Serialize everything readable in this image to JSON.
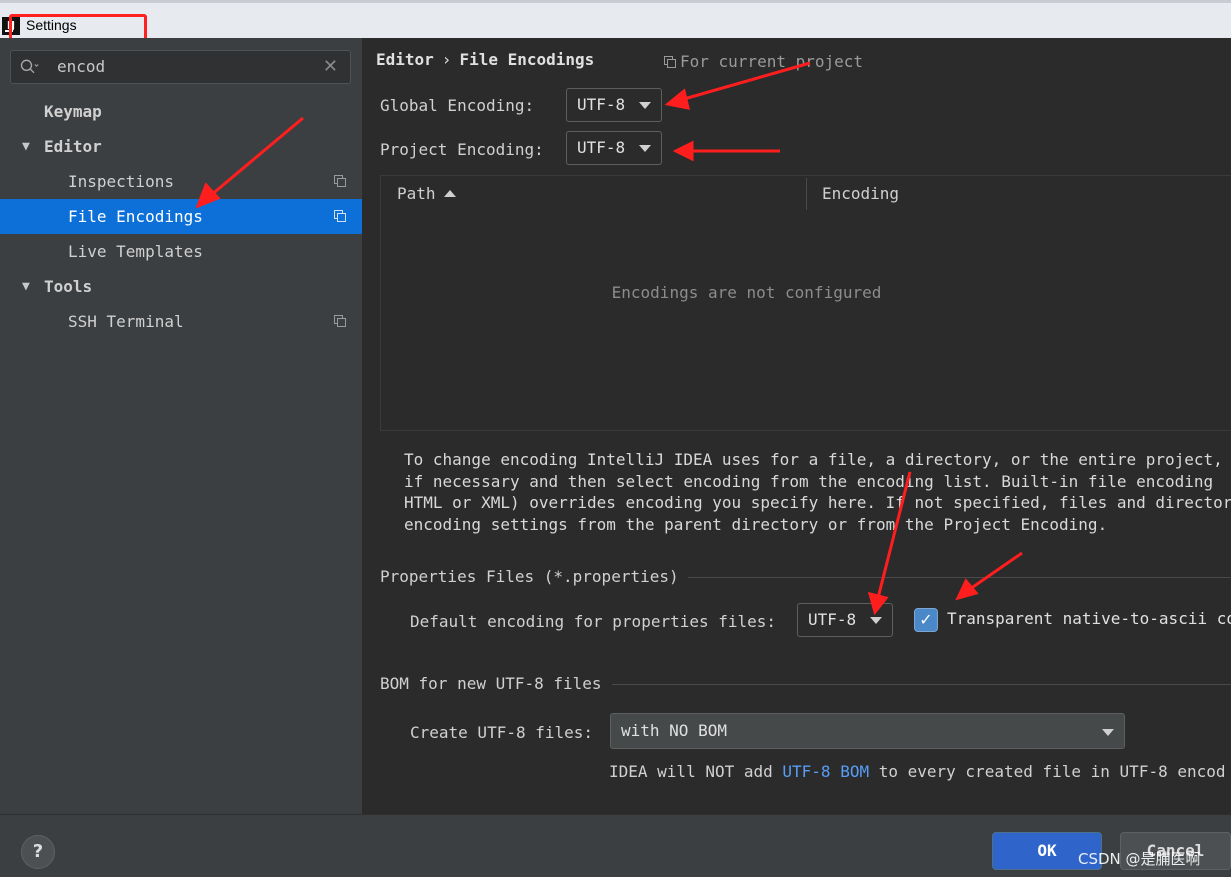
{
  "window": {
    "title": "Settings",
    "app_icon": "intellij-icon"
  },
  "search": {
    "value": "encod",
    "icon": "search-icon",
    "clear_icon": "close-icon"
  },
  "sidebar": {
    "items": [
      {
        "label": "Keymap",
        "bold": true
      },
      {
        "label": "Editor",
        "bold": true,
        "expanded": true
      },
      {
        "label": "Inspections",
        "bold": false
      },
      {
        "label": "File Encodings",
        "bold": false,
        "selected": true
      },
      {
        "label": "Live Templates",
        "bold": false
      },
      {
        "label": "Tools",
        "bold": true,
        "expanded": true
      },
      {
        "label": "SSH Terminal",
        "bold": false
      }
    ],
    "arrow_glyph": "▼"
  },
  "header": {
    "breadcrumb": [
      "Editor",
      "File Encodings"
    ],
    "separator": "›",
    "scope_label": "For current project"
  },
  "encodings": {
    "global_label": "Global Encoding:",
    "global_value": "UTF-8",
    "project_label": "Project Encoding:",
    "project_value": "UTF-8"
  },
  "table": {
    "columns": [
      "Path",
      "Encoding"
    ],
    "empty_text": "Encodings are not configured"
  },
  "help": {
    "lines": [
      "To change encoding IntelliJ IDEA uses for a file, a directory, or the entire project,",
      "if necessary and then select encoding from the encoding list. Built-in file encoding",
      "HTML or XML) overrides encoding you specify here. If not specified, files and director",
      "encoding settings from the parent directory or from the Project Encoding."
    ]
  },
  "properties": {
    "section_title": "Properties Files (*.properties)",
    "default_label": "Default encoding for properties files:",
    "default_value": "UTF-8",
    "transparent_label": "Transparent native-to-ascii co",
    "transparent_checked": true
  },
  "bom": {
    "section_title": "BOM for new UTF-8 files",
    "create_label": "Create UTF-8 files:",
    "create_value": "with NO BOM",
    "note_before": "IDEA will NOT add ",
    "note_link": "UTF-8 BOM",
    "note_after": " to every created file in UTF-8 encod"
  },
  "footer": {
    "help_label": "?",
    "ok_label": "OK",
    "cancel_label": "Cancel"
  },
  "watermark": "CSDN @是脯医啊",
  "colors": {
    "background": "#2b2b2b",
    "sidebar": "#3c3f41",
    "selection": "#0d6fd8",
    "annotation": "#ff2020",
    "link": "#589df6"
  }
}
